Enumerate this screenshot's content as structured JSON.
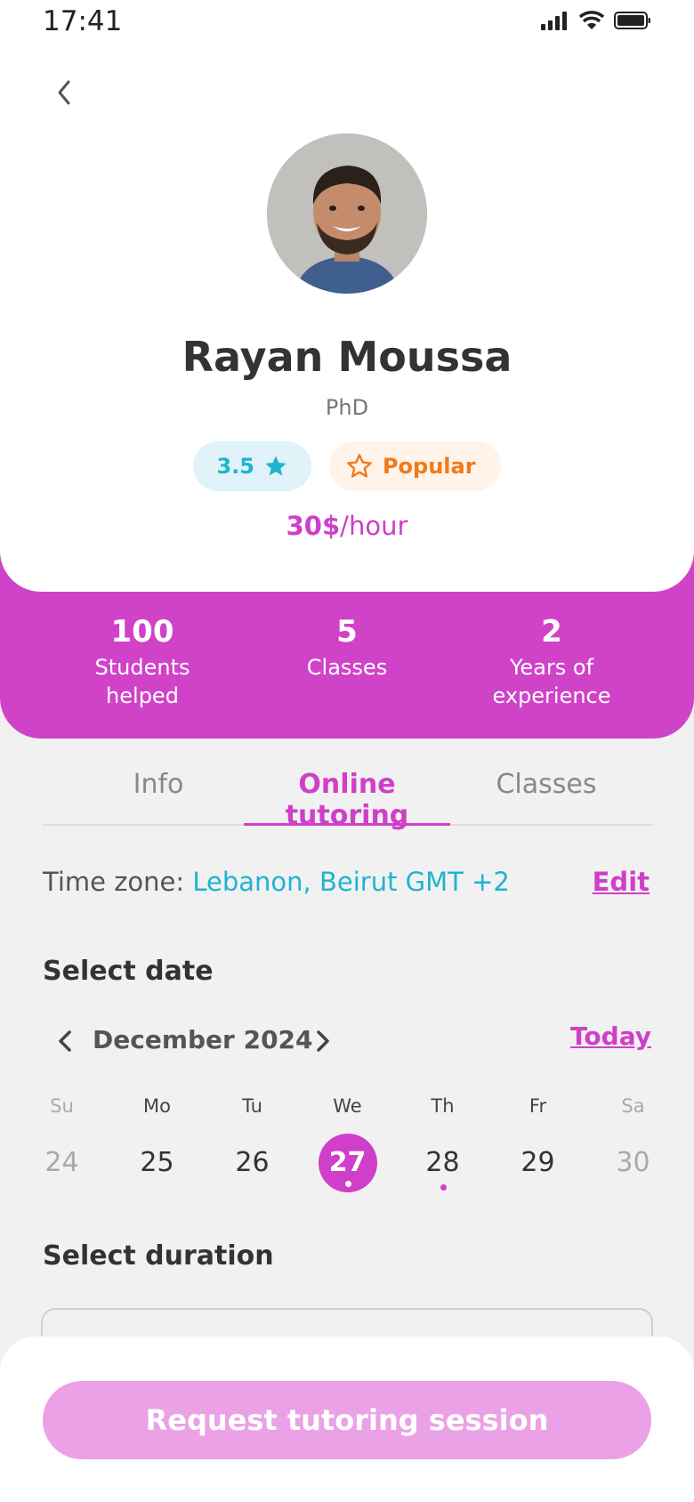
{
  "status_bar": {
    "time": "17:41"
  },
  "profile": {
    "name": "Rayan Moussa",
    "degree": "PhD",
    "rating": "3.5",
    "popular_label": "Popular",
    "price_amount": "30$",
    "price_unit": "/hour"
  },
  "stats": [
    {
      "value": "100",
      "label_line1": "Students",
      "label_line2": "helped"
    },
    {
      "value": "5",
      "label_line1": "Classes",
      "label_line2": ""
    },
    {
      "value": "2",
      "label_line1": "Years of",
      "label_line2": "experience"
    }
  ],
  "tabs": [
    {
      "label": "Info",
      "active": false
    },
    {
      "label": "Online tutoring",
      "active": true
    },
    {
      "label": "Classes",
      "active": false
    }
  ],
  "timezone": {
    "label": "Time zone: ",
    "value": "Lebanon, Beirut GMT +2",
    "edit_label": "Edit"
  },
  "select_date": {
    "title": "Select date",
    "month": "December 2024",
    "today_label": "Today",
    "days": [
      {
        "dow": "Su",
        "num": "24",
        "muted": true
      },
      {
        "dow": "Mo",
        "num": "25"
      },
      {
        "dow": "Tu",
        "num": "26"
      },
      {
        "dow": "We",
        "num": "27",
        "selected": true
      },
      {
        "dow": "Th",
        "num": "28",
        "has_event": true
      },
      {
        "dow": "Fr",
        "num": "29"
      },
      {
        "dow": "Sa",
        "num": "30",
        "muted": true
      }
    ]
  },
  "select_duration": {
    "title": "Select duration"
  },
  "cta": {
    "label": "Request tutoring session"
  },
  "colors": {
    "accent": "#cf3fc9",
    "accent_disabled": "#eaa1e5",
    "teal": "#1fb4cf",
    "orange": "#f07a1a"
  },
  "icons": [
    "back-chevron-icon",
    "star-icon",
    "star-outline-icon",
    "chevron-left-icon",
    "chevron-right-icon",
    "signal-icon",
    "wifi-icon",
    "battery-icon"
  ]
}
